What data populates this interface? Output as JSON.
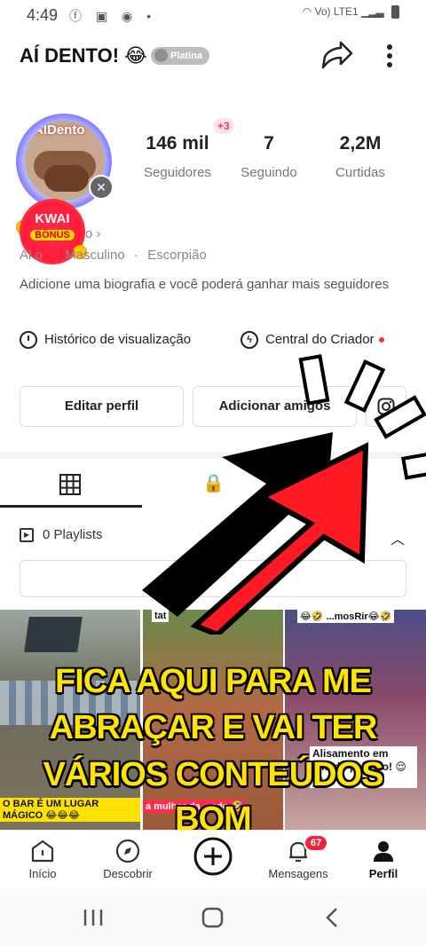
{
  "status_bar": {
    "time": "4:49",
    "left_icons": "ⓕ ▣ ◉ •",
    "network": "Vo) LTE1"
  },
  "header": {
    "name": "AÍ DENTO! 😂",
    "badge": "Platina"
  },
  "avatar": {
    "text": "AIDento"
  },
  "stats": [
    {
      "value": "146 mil",
      "label": "Seguidores"
    },
    {
      "value": "7",
      "label": "Seguindo"
    },
    {
      "value": "2,2M",
      "label": "Curtidas"
    }
  ],
  "followers_new": "+3",
  "kwai_bonus": {
    "line1": "KWAI",
    "line2": "BÔNUS"
  },
  "info": {
    "id_suffix": "o ›",
    "fragment": "Al  o",
    "gender": "Masculino",
    "sign": "Escorpião",
    "sep": "·"
  },
  "bio": "Adicione uma biografia e você poderá ganhar mais seguidores",
  "links": {
    "history": "Histórico de visualização",
    "creator": "Central do Criador"
  },
  "buttons": {
    "edit": "Editar perfil",
    "add_friends": "Adicionar amigos"
  },
  "playlists": {
    "label": "0 Playlists"
  },
  "thumbnails": [
    {
      "top_cap": "",
      "bottom_cap": "O BAR É UM LUGAR MÁGICO 😂😂😂"
    },
    {
      "top_cap": "tat",
      "bottom_cap": "a mulher da... ado 🤣"
    },
    {
      "top_cap": "😂🤣 ...mosRir😂🤣",
      "bottom_cap": "Alisamento em ...ltado perfeito! 😌😌"
    }
  ],
  "overlay": {
    "line1": "FICA AQUI PARA ME",
    "line2": "ABRAÇAR E VAI TER",
    "line3": "VÁRIOS CONTEÚDOS",
    "line4": "BOM"
  },
  "nav": [
    {
      "label": "Início"
    },
    {
      "label": "Descobrir"
    },
    {
      "label": ""
    },
    {
      "label": "Mensagens"
    },
    {
      "label": "Perfil"
    }
  ],
  "messages_badge": "67",
  "colors": {
    "accent_red": "#f2343c",
    "overlay_yellow": "#ffe400",
    "arrow_red": "#ff1a24"
  }
}
